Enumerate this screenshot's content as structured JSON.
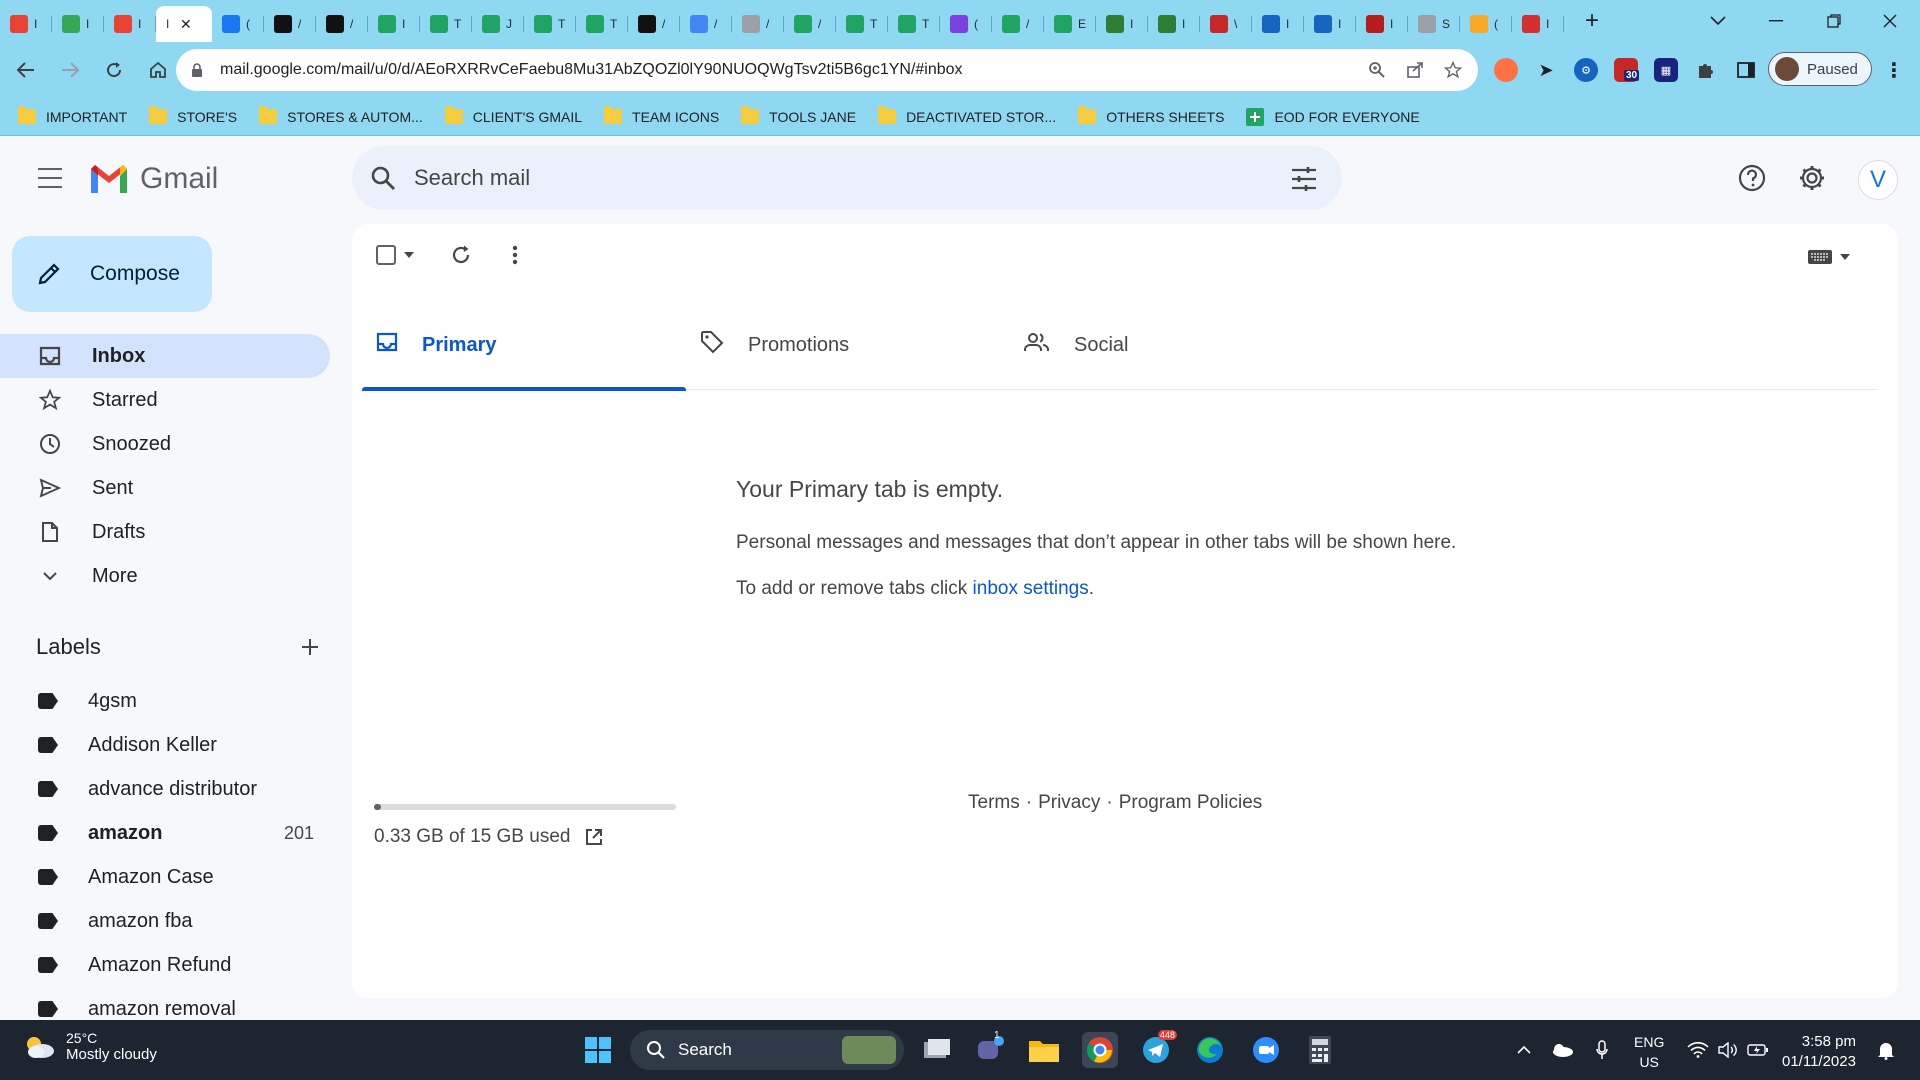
{
  "browser": {
    "active_tab_title": "I",
    "tabs": [
      {
        "icon": "gmail-icon",
        "title": "I",
        "color": "#ea4335"
      },
      {
        "icon": "drive-icon",
        "title": "I",
        "color": "#34a853"
      },
      {
        "icon": "gmail-icon",
        "title": "I",
        "color": "#ea4335"
      },
      {
        "icon": "facebook-icon",
        "title": "(",
        "color": "#1877f2"
      },
      {
        "icon": "amazon-icon",
        "title": "/",
        "color": "#111111"
      },
      {
        "icon": "amazon-icon",
        "title": "/",
        "color": "#111111"
      },
      {
        "icon": "sheets-icon",
        "title": "I",
        "color": "#1fa463"
      },
      {
        "icon": "sheets-icon",
        "title": "T",
        "color": "#1fa463"
      },
      {
        "icon": "sheets-icon",
        "title": "J",
        "color": "#1fa463"
      },
      {
        "icon": "sheets-icon",
        "title": "T",
        "color": "#1fa463"
      },
      {
        "icon": "sheets-icon",
        "title": "T",
        "color": "#1fa463"
      },
      {
        "icon": "threads-icon",
        "title": "/",
        "color": "#111111"
      },
      {
        "icon": "pencil-icon",
        "title": "/",
        "color": "#4285f4"
      },
      {
        "icon": "globe-icon",
        "title": "/",
        "color": "#9aa0a6"
      },
      {
        "icon": "sheets-icon",
        "title": "/",
        "color": "#1fa463"
      },
      {
        "icon": "sheets-icon",
        "title": "T",
        "color": "#1fa463"
      },
      {
        "icon": "sheets-icon",
        "title": "T",
        "color": "#1fa463"
      },
      {
        "icon": "chat-icon",
        "title": "(",
        "color": "#7b3fe4"
      },
      {
        "icon": "sheets-icon",
        "title": "/",
        "color": "#1fa463"
      },
      {
        "icon": "sheets-icon",
        "title": "E",
        "color": "#1fa463"
      },
      {
        "icon": "w-icon",
        "title": "I",
        "color": "#2e7d32"
      },
      {
        "icon": "w-icon",
        "title": "I",
        "color": "#2e7d32"
      },
      {
        "icon": "ww-icon",
        "title": "\\",
        "color": "#c62828"
      },
      {
        "icon": "cloud-icon",
        "title": "I",
        "color": "#1565c0"
      },
      {
        "icon": "cloud-icon",
        "title": "I",
        "color": "#1565c0"
      },
      {
        "icon": "car-icon",
        "title": "I",
        "color": "#b71c1c"
      },
      {
        "icon": "globe-icon",
        "title": "S",
        "color": "#9aa0a6"
      },
      {
        "icon": "coin-icon",
        "title": "(",
        "color": "#f9a825"
      },
      {
        "icon": "shield-icon",
        "title": "I",
        "color": "#d32f2f"
      }
    ],
    "url": "mail.google.com/mail/u/0/d/AEoRXRRvCeFaebu8Mu31AbZQOZl0lY90NUOQWgTsv2ti5B6gc1YN/#inbox",
    "profile_label": "Paused",
    "ext_badge": "30",
    "bookmarks": [
      {
        "label": "IMPORTANT",
        "icon": "folder-icon"
      },
      {
        "label": "STORE'S",
        "icon": "folder-icon"
      },
      {
        "label": "STORES & AUTOM...",
        "icon": "folder-icon"
      },
      {
        "label": "CLIENT'S GMAIL",
        "icon": "folder-icon"
      },
      {
        "label": "TEAM ICONS",
        "icon": "folder-icon"
      },
      {
        "label": "TOOLS JANE",
        "icon": "folder-icon"
      },
      {
        "label": "DEACTIVATED STOR...",
        "icon": "folder-icon"
      },
      {
        "label": "OTHERS SHEETS",
        "icon": "folder-icon"
      },
      {
        "label": "EOD FOR EVERYONE",
        "icon": "sheets-icon"
      }
    ]
  },
  "gmail": {
    "app_name": "Gmail",
    "search_placeholder": "Search mail",
    "avatar_letter": "V",
    "compose_label": "Compose",
    "nav": [
      {
        "label": "Inbox",
        "icon": "inbox-icon",
        "active": true
      },
      {
        "label": "Starred",
        "icon": "star-icon"
      },
      {
        "label": "Snoozed",
        "icon": "clock-icon"
      },
      {
        "label": "Sent",
        "icon": "send-icon"
      },
      {
        "label": "Drafts",
        "icon": "draft-icon"
      },
      {
        "label": "More",
        "icon": "chevron-down-icon"
      }
    ],
    "labels_heading": "Labels",
    "labels": [
      {
        "label": "4gsm"
      },
      {
        "label": "Addison Keller"
      },
      {
        "label": "advance distributor"
      },
      {
        "label": "amazon",
        "count": "201",
        "bold": true
      },
      {
        "label": "Amazon Case"
      },
      {
        "label": "amazon fba"
      },
      {
        "label": "Amazon Refund"
      },
      {
        "label": "amazon removal"
      }
    ],
    "category_tabs": [
      {
        "label": "Primary",
        "icon": "inbox-icon",
        "active": true
      },
      {
        "label": "Promotions",
        "icon": "tag-icon"
      },
      {
        "label": "Social",
        "icon": "people-icon"
      }
    ],
    "empty_title": "Your Primary tab is empty.",
    "empty_desc": "Personal messages and messages that don’t appear in other tabs will be shown here.",
    "empty_settings_prefix": "To add or remove tabs click ",
    "empty_settings_link": "inbox settings",
    "empty_settings_suffix": ".",
    "storage_text": "0.33 GB of 15 GB used",
    "storage_fraction": 0.022,
    "footer": {
      "terms": "Terms",
      "sep": "·",
      "privacy": "Privacy",
      "policies": "Program Policies"
    }
  },
  "taskbar": {
    "temperature": "25°C",
    "weather": "Mostly cloudy",
    "search_label": "Search",
    "chat_badge": "1",
    "telegram_badge": "448",
    "lang_top": "ENG",
    "lang_bottom": "US",
    "time": "3:58 pm",
    "date": "01/11/2023"
  }
}
